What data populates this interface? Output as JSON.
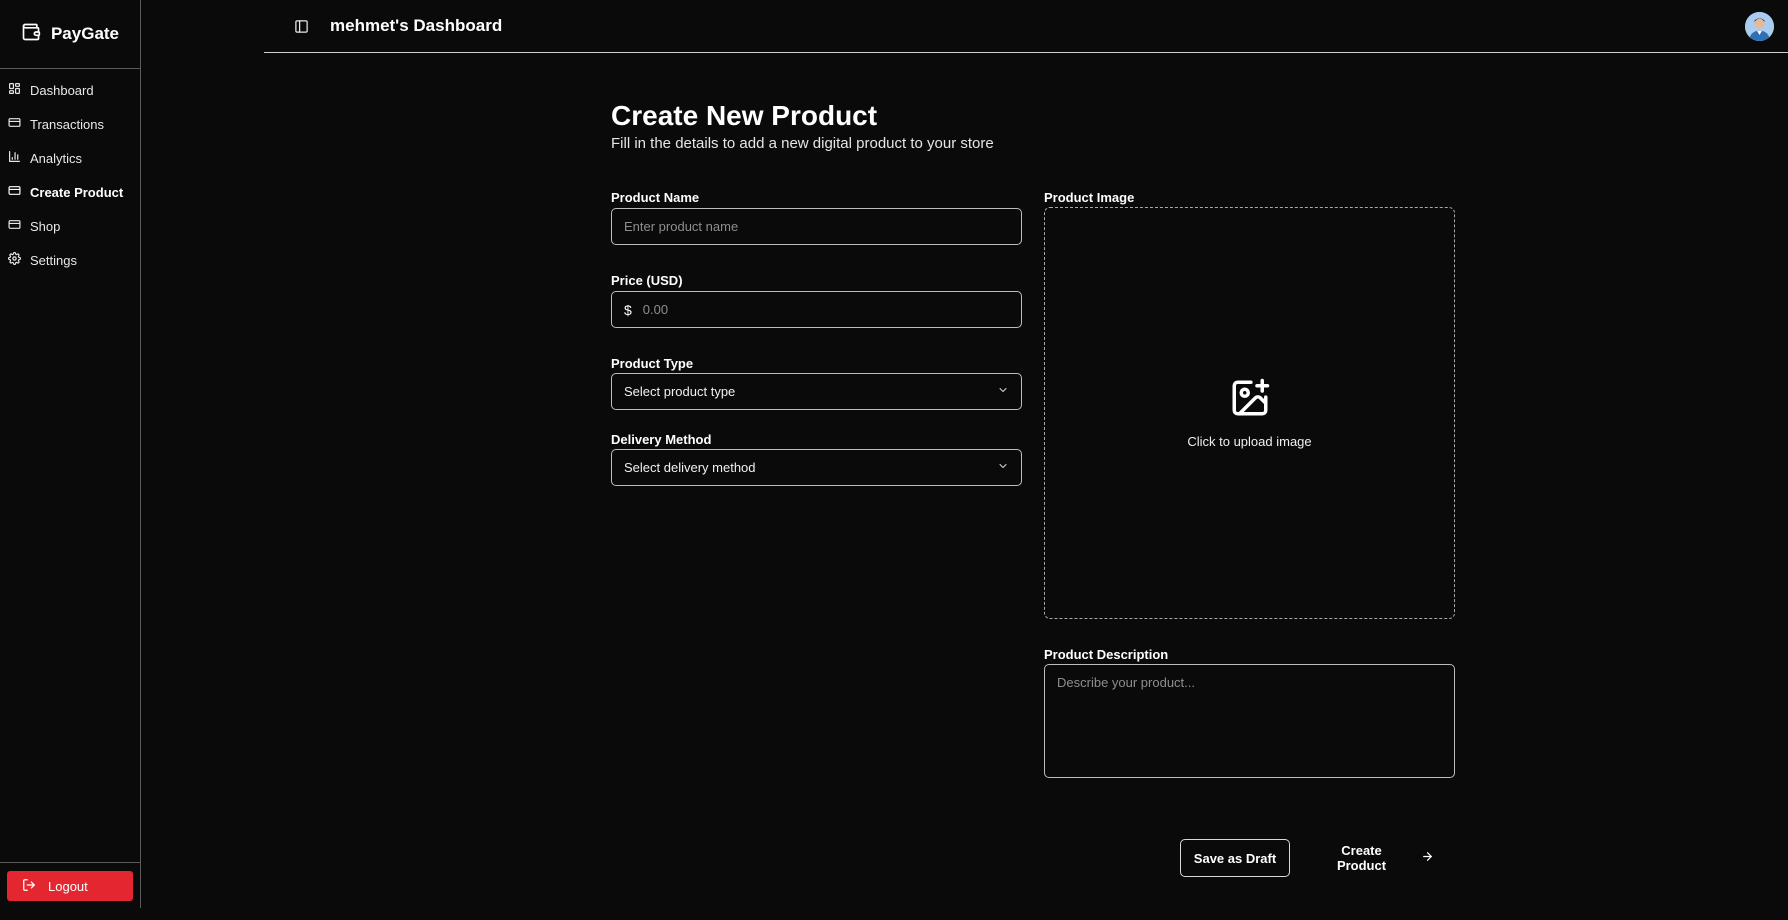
{
  "sidebar": {
    "brand": "PayGate",
    "items": [
      {
        "label": "Dashboard",
        "icon": "layout-grid-icon"
      },
      {
        "label": "Transactions",
        "icon": "credit-card-icon"
      },
      {
        "label": "Analytics",
        "icon": "bar-chart-icon"
      },
      {
        "label": "Create Product",
        "icon": "credit-card-icon",
        "active": true
      },
      {
        "label": "Shop",
        "icon": "credit-card-icon"
      },
      {
        "label": "Settings",
        "icon": "gear-icon"
      }
    ],
    "logout_label": "Logout"
  },
  "header": {
    "title": "mehmet's Dashboard"
  },
  "main": {
    "title": "Create New Product",
    "subtitle": "Fill in the details to add a new digital product to your store",
    "product_name": {
      "label": "Product Name",
      "placeholder": "Enter product name",
      "value": ""
    },
    "price": {
      "label": "Price (USD)",
      "currency_symbol": "$",
      "placeholder": "0.00",
      "value": ""
    },
    "product_type": {
      "label": "Product Type",
      "selected": "Select product type"
    },
    "delivery_method": {
      "label": "Delivery Method",
      "selected": "Select delivery method"
    },
    "product_image": {
      "label": "Product Image",
      "upload_text": "Click to upload image"
    },
    "description": {
      "label": "Product Description",
      "placeholder": "Describe your product...",
      "value": ""
    },
    "save_draft_label": "Save as Draft",
    "create_label": "Create Product"
  },
  "colors": {
    "background": "#0a0a0a",
    "logout": "#e3262f",
    "text": "#ffffff",
    "border": "#bdbdbd"
  }
}
